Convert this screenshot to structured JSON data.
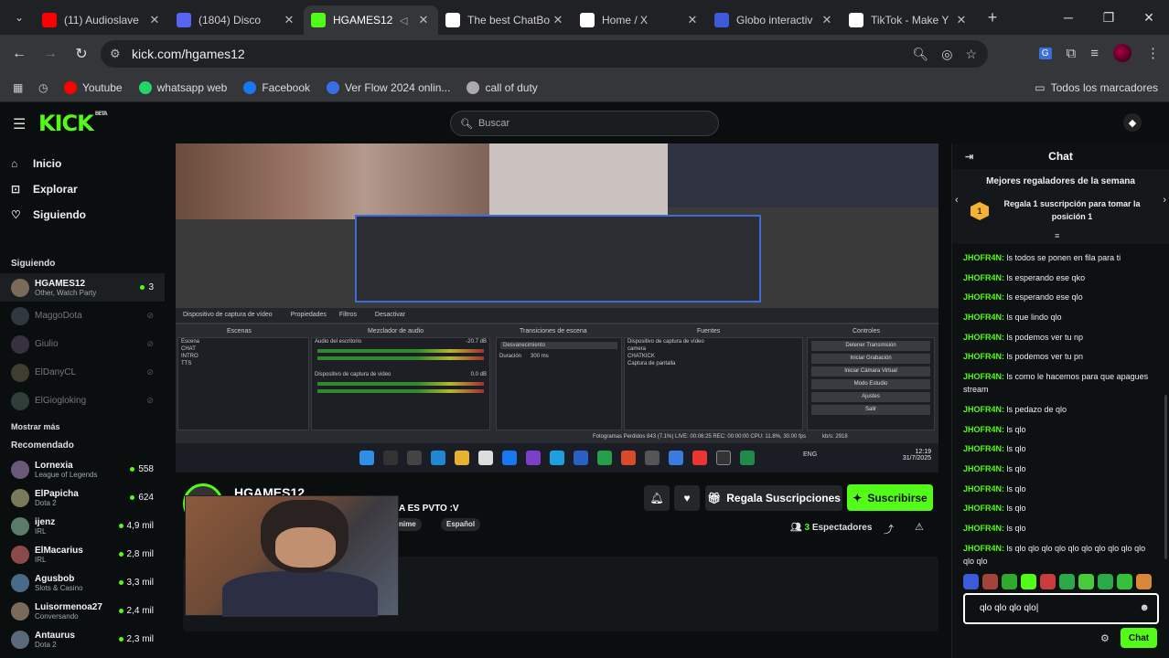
{
  "browser": {
    "tabs": [
      {
        "title": "(11) Audioslave",
        "icon": "youtube-icon",
        "color": "#ff0000"
      },
      {
        "title": "(1804) Disco",
        "icon": "discord-icon",
        "color": "#5865f2"
      },
      {
        "title": "HGAMES12",
        "icon": "kick-icon",
        "color": "#53fc18",
        "active": true
      },
      {
        "title": "The best ChatBo",
        "icon": "chatbot-icon",
        "color": "#ffffff"
      },
      {
        "title": "Home / X",
        "icon": "x-icon",
        "color": "#ffffff"
      },
      {
        "title": "Globo interactiv",
        "icon": "globo-icon",
        "color": "#3b5bdb"
      },
      {
        "title": "TikTok - Make Y",
        "icon": "tiktok-icon",
        "color": "#ffffff"
      }
    ],
    "url": "kick.com/hgames12",
    "bookmarks": [
      {
        "label": "Youtube",
        "icon": "youtube-icon",
        "color": "#ff0000"
      },
      {
        "label": "whatsapp web",
        "icon": "whatsapp-icon",
        "color": "#25d366"
      },
      {
        "label": "Facebook",
        "icon": "facebook-icon",
        "color": "#1877f2"
      },
      {
        "label": "Ver Flow 2024 onlin...",
        "icon": "flow-icon",
        "color": "#3a6ee8"
      },
      {
        "label": "call of duty",
        "icon": "cod-icon",
        "color": "#aaaaaa"
      }
    ],
    "all_bookmarks": "Todos los marcadores"
  },
  "kick": {
    "logo": "KICK",
    "logo_badge": "BETA",
    "search_placeholder": "Buscar",
    "nav": [
      {
        "label": "Inicio",
        "icon": "home-icon"
      },
      {
        "label": "Explorar",
        "icon": "compass-icon"
      },
      {
        "label": "Siguiendo",
        "icon": "heart-icon"
      }
    ],
    "following_title": "Siguiendo",
    "following": [
      {
        "name": "HGAMES12",
        "category": "Other, Watch Party",
        "viewers": "3",
        "live": true
      },
      {
        "name": "MaggoDota",
        "live": false
      },
      {
        "name": "Giulio",
        "live": false
      },
      {
        "name": "ElDanyCL",
        "live": false
      },
      {
        "name": "ElGiogloking",
        "live": false
      }
    ],
    "show_more": "Mostrar más",
    "recommended_title": "Recomendado",
    "recommended": [
      {
        "name": "Lornexia",
        "category": "League of Legends",
        "viewers": "558"
      },
      {
        "name": "ElPapicha",
        "category": "Dota 2",
        "viewers": "624"
      },
      {
        "name": "ijenz",
        "category": "IRL",
        "viewers": "4,9 mil"
      },
      {
        "name": "ElMacarius",
        "category": "IRL",
        "viewers": "2,8 mil"
      },
      {
        "name": "Agusbob",
        "category": "Slots & Casino",
        "viewers": "3,3 mil"
      },
      {
        "name": "Luisormenoa27",
        "category": "Conversando",
        "viewers": "2,4 mil"
      },
      {
        "name": "Antaurus",
        "category": "Dota 2",
        "viewers": "2,3 mil"
      }
    ]
  },
  "stream": {
    "streamer": "HGAMES12",
    "title": "A ES PVTO :V",
    "tags": [
      "nime",
      "Español"
    ],
    "gift_label": "Regala Suscripciones",
    "subscribe_label": "Suscribirse",
    "viewers_count": "3",
    "viewers_label": "Espectadores",
    "obs": {
      "source_label": "Dispositivo de captura de vídeo",
      "props": "Propiedades",
      "filters": "Filtros",
      "deactivate": "Desactivar",
      "scenes_title": "Escenas",
      "scenes": [
        "Escena",
        "CHAT",
        "INTRO",
        "TTS"
      ],
      "mixer_title": "Mezclador de audio",
      "mixer_desktop": "Audio del escritorio",
      "mixer_desktop_db": "-20.7 dB",
      "mixer_capture": "Dispositivo de captura de video",
      "mixer_capture_db": "0.0 dB",
      "transitions_title": "Transiciones de escena",
      "transition_value": "Desvanecimiento",
      "duration_label": "Duración",
      "duration_value": "300 ms",
      "sources_title": "Fuentes",
      "sources": [
        "Dispositivo de captura de vídeo",
        "camera",
        "CHATKICK",
        "Captura de pantalla"
      ],
      "controls_title": "Controles",
      "controls": [
        "Detener Transmisión",
        "Iniciar Grabación",
        "Iniciar Cámara Virtual",
        "Modo Estudio",
        "Ajustes",
        "Salir"
      ],
      "status": "Fotogramas Perdidos 843 (7.1%)    LIVE: 00:06:25    REC: 00:00:00    CPU: 11.8%, 30.00 fps",
      "kbps": "kb/s: 2918",
      "lang": "ENG",
      "time": "12:19",
      "date": "31/7/2025"
    }
  },
  "chat": {
    "title": "Chat",
    "gifters_title": "Mejores regaladores de la semana",
    "gifters_cta": "Regala 1 suscripción para tomar la posición 1",
    "rank": "1",
    "messages": [
      {
        "user": "JHOFR4N",
        "text": "ls todos se ponen en fila para ti"
      },
      {
        "user": "JHOFR4N",
        "text": "ls esperando ese qko"
      },
      {
        "user": "JHOFR4N",
        "text": "ls esperando ese qlo"
      },
      {
        "user": "JHOFR4N",
        "text": "ls que lindo qlo"
      },
      {
        "user": "JHOFR4N",
        "text": "ls podemos ver tu np"
      },
      {
        "user": "JHOFR4N",
        "text": "ls podemos ver tu pn"
      },
      {
        "user": "JHOFR4N",
        "text": "ls como le hacemos para que apagues stream"
      },
      {
        "user": "JHOFR4N",
        "text": "ls pedazo de qlo"
      },
      {
        "user": "JHOFR4N",
        "text": "ls qlo"
      },
      {
        "user": "JHOFR4N",
        "text": "ls qlo"
      },
      {
        "user": "JHOFR4N",
        "text": "ls qlo"
      },
      {
        "user": "JHOFR4N",
        "text": "ls qlo"
      },
      {
        "user": "JHOFR4N",
        "text": "ls qlo"
      },
      {
        "user": "JHOFR4N",
        "text": "ls qlo"
      },
      {
        "user": "JHOFR4N",
        "text": "ls qlo qlo qlo qlo qlo qlo qlo qlo qlo qlo qlo qlo"
      }
    ],
    "input_value": "qlo qlo qlo qlo",
    "send_label": "Chat"
  }
}
